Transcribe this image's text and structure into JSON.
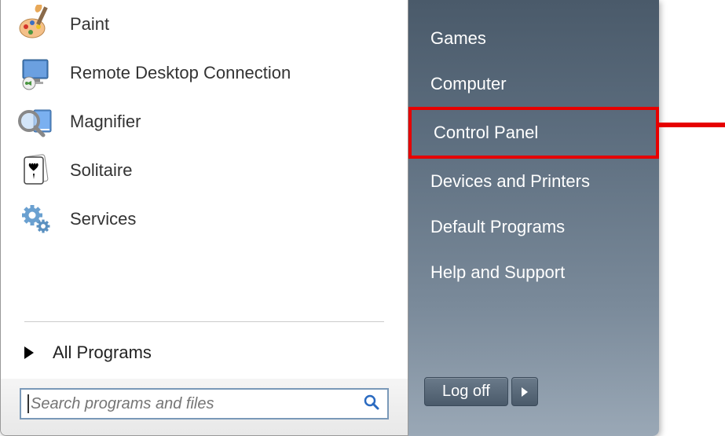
{
  "programs": [
    {
      "label": "Paint",
      "icon": "paint"
    },
    {
      "label": "Remote Desktop Connection",
      "icon": "remote-desktop"
    },
    {
      "label": "Magnifier",
      "icon": "magnifier"
    },
    {
      "label": "Solitaire",
      "icon": "solitaire"
    },
    {
      "label": "Services",
      "icon": "services"
    }
  ],
  "allPrograms": "All Programs",
  "search": {
    "placeholder": "Search programs and files"
  },
  "systemItems": [
    {
      "label": "Games",
      "highlighted": false
    },
    {
      "label": "Computer",
      "highlighted": false
    },
    {
      "label": "Control Panel",
      "highlighted": true
    },
    {
      "label": "Devices and Printers",
      "highlighted": false
    },
    {
      "label": "Default Programs",
      "highlighted": false
    },
    {
      "label": "Help and Support",
      "highlighted": false
    }
  ],
  "logoff": {
    "label": "Log off"
  },
  "colors": {
    "highlight": "#e60000"
  }
}
